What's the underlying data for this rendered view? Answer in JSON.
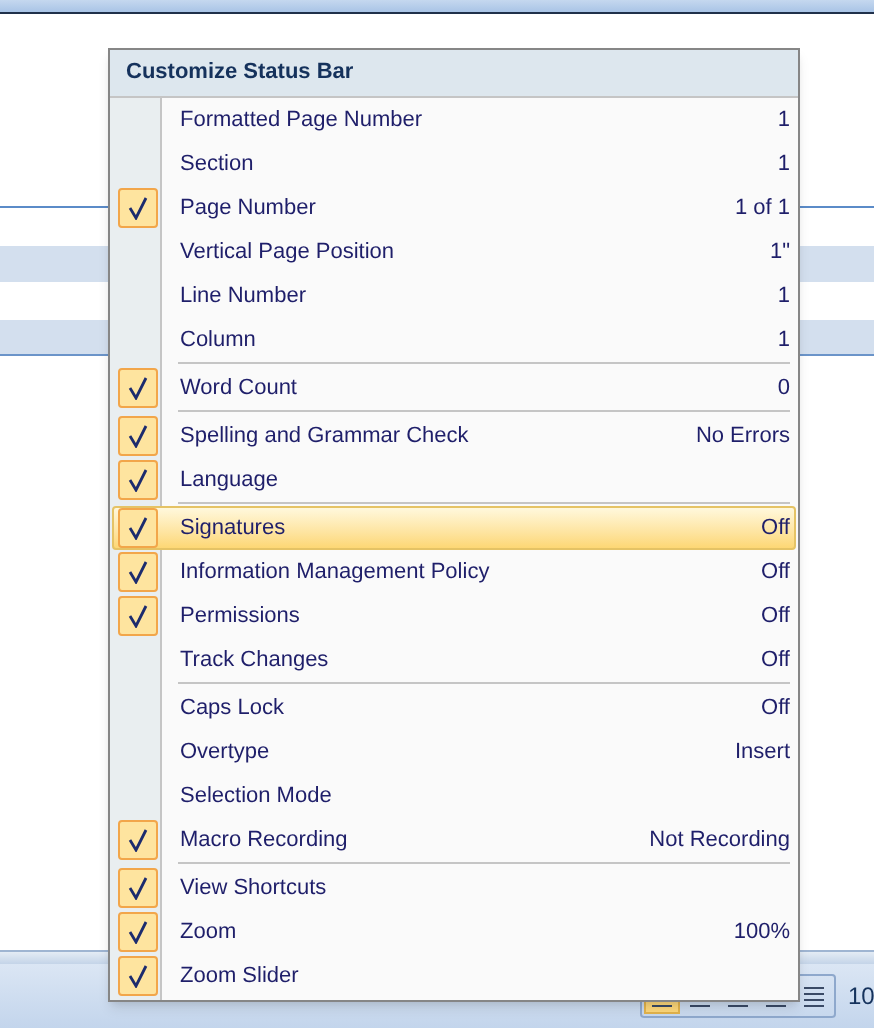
{
  "menu": {
    "title": "Customize Status Bar",
    "groups": [
      {
        "items": [
          {
            "label": "Formatted Page Number",
            "value": "1",
            "checked": false,
            "selected": false
          },
          {
            "label": "Section",
            "value": "1",
            "checked": false,
            "selected": false
          },
          {
            "label": "Page Number",
            "value": "1 of 1",
            "checked": true,
            "selected": false
          },
          {
            "label": "Vertical Page Position",
            "value": "1\"",
            "checked": false,
            "selected": false
          },
          {
            "label": "Line Number",
            "value": "1",
            "checked": false,
            "selected": false
          },
          {
            "label": "Column",
            "value": "1",
            "checked": false,
            "selected": false
          }
        ]
      },
      {
        "items": [
          {
            "label": "Word Count",
            "value": "0",
            "checked": true,
            "selected": false
          }
        ]
      },
      {
        "items": [
          {
            "label": "Spelling and Grammar Check",
            "value": "No Errors",
            "checked": true,
            "selected": false
          },
          {
            "label": "Language",
            "checked": true,
            "selected": false
          }
        ]
      },
      {
        "items": [
          {
            "label": "Signatures",
            "value": "Off",
            "checked": true,
            "selected": true
          },
          {
            "label": "Information Management Policy",
            "value": "Off",
            "checked": true,
            "selected": false
          },
          {
            "label": "Permissions",
            "value": "Off",
            "checked": true,
            "selected": false
          },
          {
            "label": "Track Changes",
            "value": "Off",
            "checked": false,
            "selected": false
          }
        ]
      },
      {
        "items": [
          {
            "label": "Caps Lock",
            "value": "Off",
            "checked": false,
            "selected": false
          },
          {
            "label": "Overtype",
            "value": "Insert",
            "checked": false,
            "selected": false
          },
          {
            "label": "Selection Mode",
            "checked": false,
            "selected": false
          },
          {
            "label": "Macro Recording",
            "value": "Not Recording",
            "checked": true,
            "selected": false
          }
        ]
      },
      {
        "items": [
          {
            "label": "View Shortcuts",
            "checked": true,
            "selected": false
          },
          {
            "label": "Zoom",
            "value": "100%",
            "checked": true,
            "selected": false
          },
          {
            "label": "Zoom Slider",
            "checked": true,
            "selected": false
          }
        ]
      }
    ]
  },
  "status_bar": {
    "view_buttons": [
      {
        "selected": true
      },
      {
        "selected": false
      },
      {
        "selected": false
      },
      {
        "selected": false
      },
      {
        "selected": false
      }
    ],
    "zoom_text": "10"
  }
}
